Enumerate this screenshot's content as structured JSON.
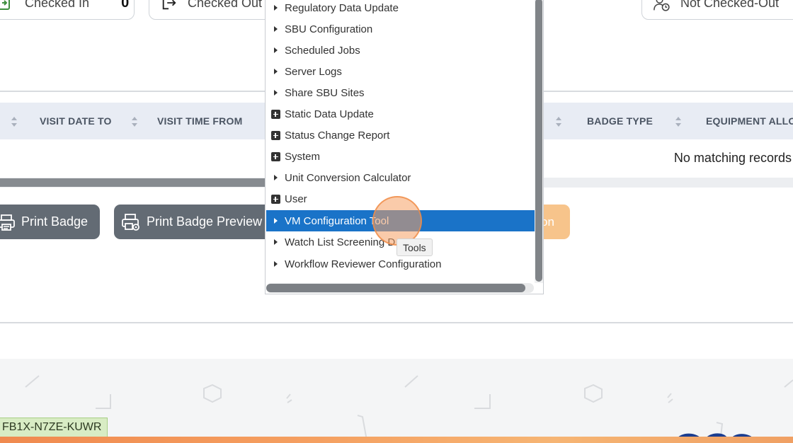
{
  "stats": {
    "checked_in_label": "Checked In",
    "checked_in_count": "0",
    "checked_out_label": "Checked Out",
    "not_checked_out_label": "Not Checked-Out"
  },
  "table": {
    "columns": [
      "VISIT DATE TO",
      "VISIT TIME FROM",
      "BADGE TYPE",
      "EQUIPMENT ALLO"
    ],
    "empty_message": "No matching records"
  },
  "buttons": {
    "print_badge": "Print Badge",
    "print_badge_preview": "Print Badge Preview",
    "partial_action": "on"
  },
  "dropdown": {
    "items": [
      {
        "label": "Regulatory Data Update",
        "marker": "triangle"
      },
      {
        "label": "SBU Configuration",
        "marker": "triangle"
      },
      {
        "label": "Scheduled Jobs",
        "marker": "triangle"
      },
      {
        "label": "Server Logs",
        "marker": "triangle"
      },
      {
        "label": "Share SBU Sites",
        "marker": "triangle"
      },
      {
        "label": "Static Data Update",
        "marker": "plus"
      },
      {
        "label": "Status Change Report",
        "marker": "plus"
      },
      {
        "label": "System",
        "marker": "plus"
      },
      {
        "label": "Unit Conversion Calculator",
        "marker": "triangle"
      },
      {
        "label": "User",
        "marker": "plus"
      },
      {
        "label": "VM Configuration Tool",
        "marker": "triangle",
        "selected": true
      },
      {
        "label": "Watch List Screening D",
        "marker": "triangle"
      },
      {
        "label": "Workflow Reviewer Configuration",
        "marker": "triangle"
      }
    ],
    "selected_color": "#1a73c8"
  },
  "tooltip": "Tools",
  "footer": {
    "code": "FB1X-N7ZE-KUWR"
  },
  "colors": {
    "button_gray": "#636b74",
    "accent_orange": "#f7c48b",
    "table_header_bg": "#e8ecf4"
  }
}
